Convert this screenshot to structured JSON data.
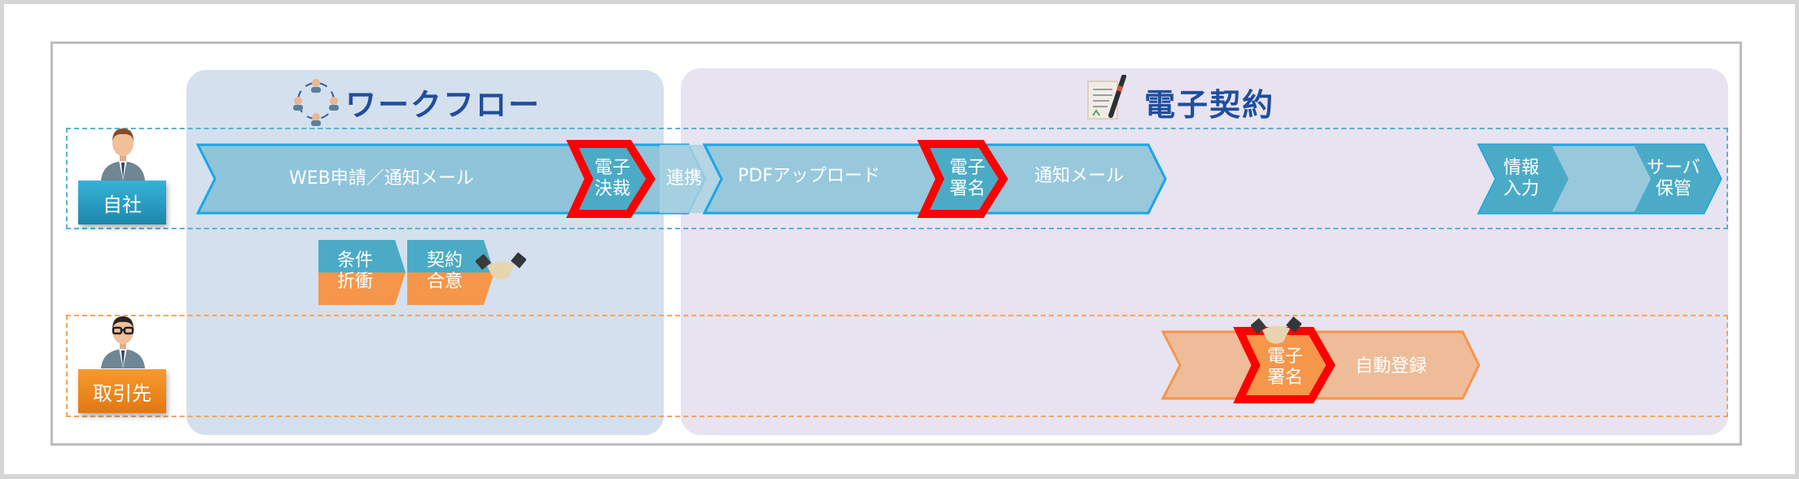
{
  "sections": {
    "workflow": {
      "title": "ワークフロー",
      "icon": "people-cycle-icon"
    },
    "econtract": {
      "title": "電子契約",
      "icon": "document-pen-icon"
    }
  },
  "roles": {
    "self": {
      "label": "自社",
      "icon": "businessman-icon"
    },
    "partner": {
      "label": "取引先",
      "icon": "businessman-glasses-icon"
    }
  },
  "self_lane": {
    "steps": [
      {
        "label": "WEB申請／通知メール"
      },
      {
        "label_line1": "電子",
        "label_line2": "決裁",
        "highlighted": true
      },
      {
        "label": "連携"
      },
      {
        "label": "PDFアップロード"
      },
      {
        "label_line1": "電子",
        "label_line2": "署名",
        "highlighted": true
      },
      {
        "label": "通知メール"
      },
      {
        "label_line1": "情報",
        "label_line2": "入力"
      },
      {
        "label_line1": "サーバ",
        "label_line2": "保管"
      }
    ]
  },
  "negotiation": {
    "steps": [
      {
        "label_line1": "条件",
        "label_line2": "折衝"
      },
      {
        "label_line1": "契約",
        "label_line2": "合意"
      }
    ],
    "icon": "handshake-icon"
  },
  "partner_lane": {
    "steps": [
      {
        "label_line1": "電子",
        "label_line2": "署名",
        "highlighted": true
      },
      {
        "label": "自動登録"
      }
    ],
    "icon": "handshake-icon"
  },
  "colors": {
    "blue_arrow": "#8fc4da",
    "blue_dark": "#4babc6",
    "blue_border": "#1aa6e6",
    "orange_arrow": "#eebc98",
    "orange_dark": "#f5964a",
    "highlight": "#ff0000",
    "title": "#1f4e9c"
  }
}
